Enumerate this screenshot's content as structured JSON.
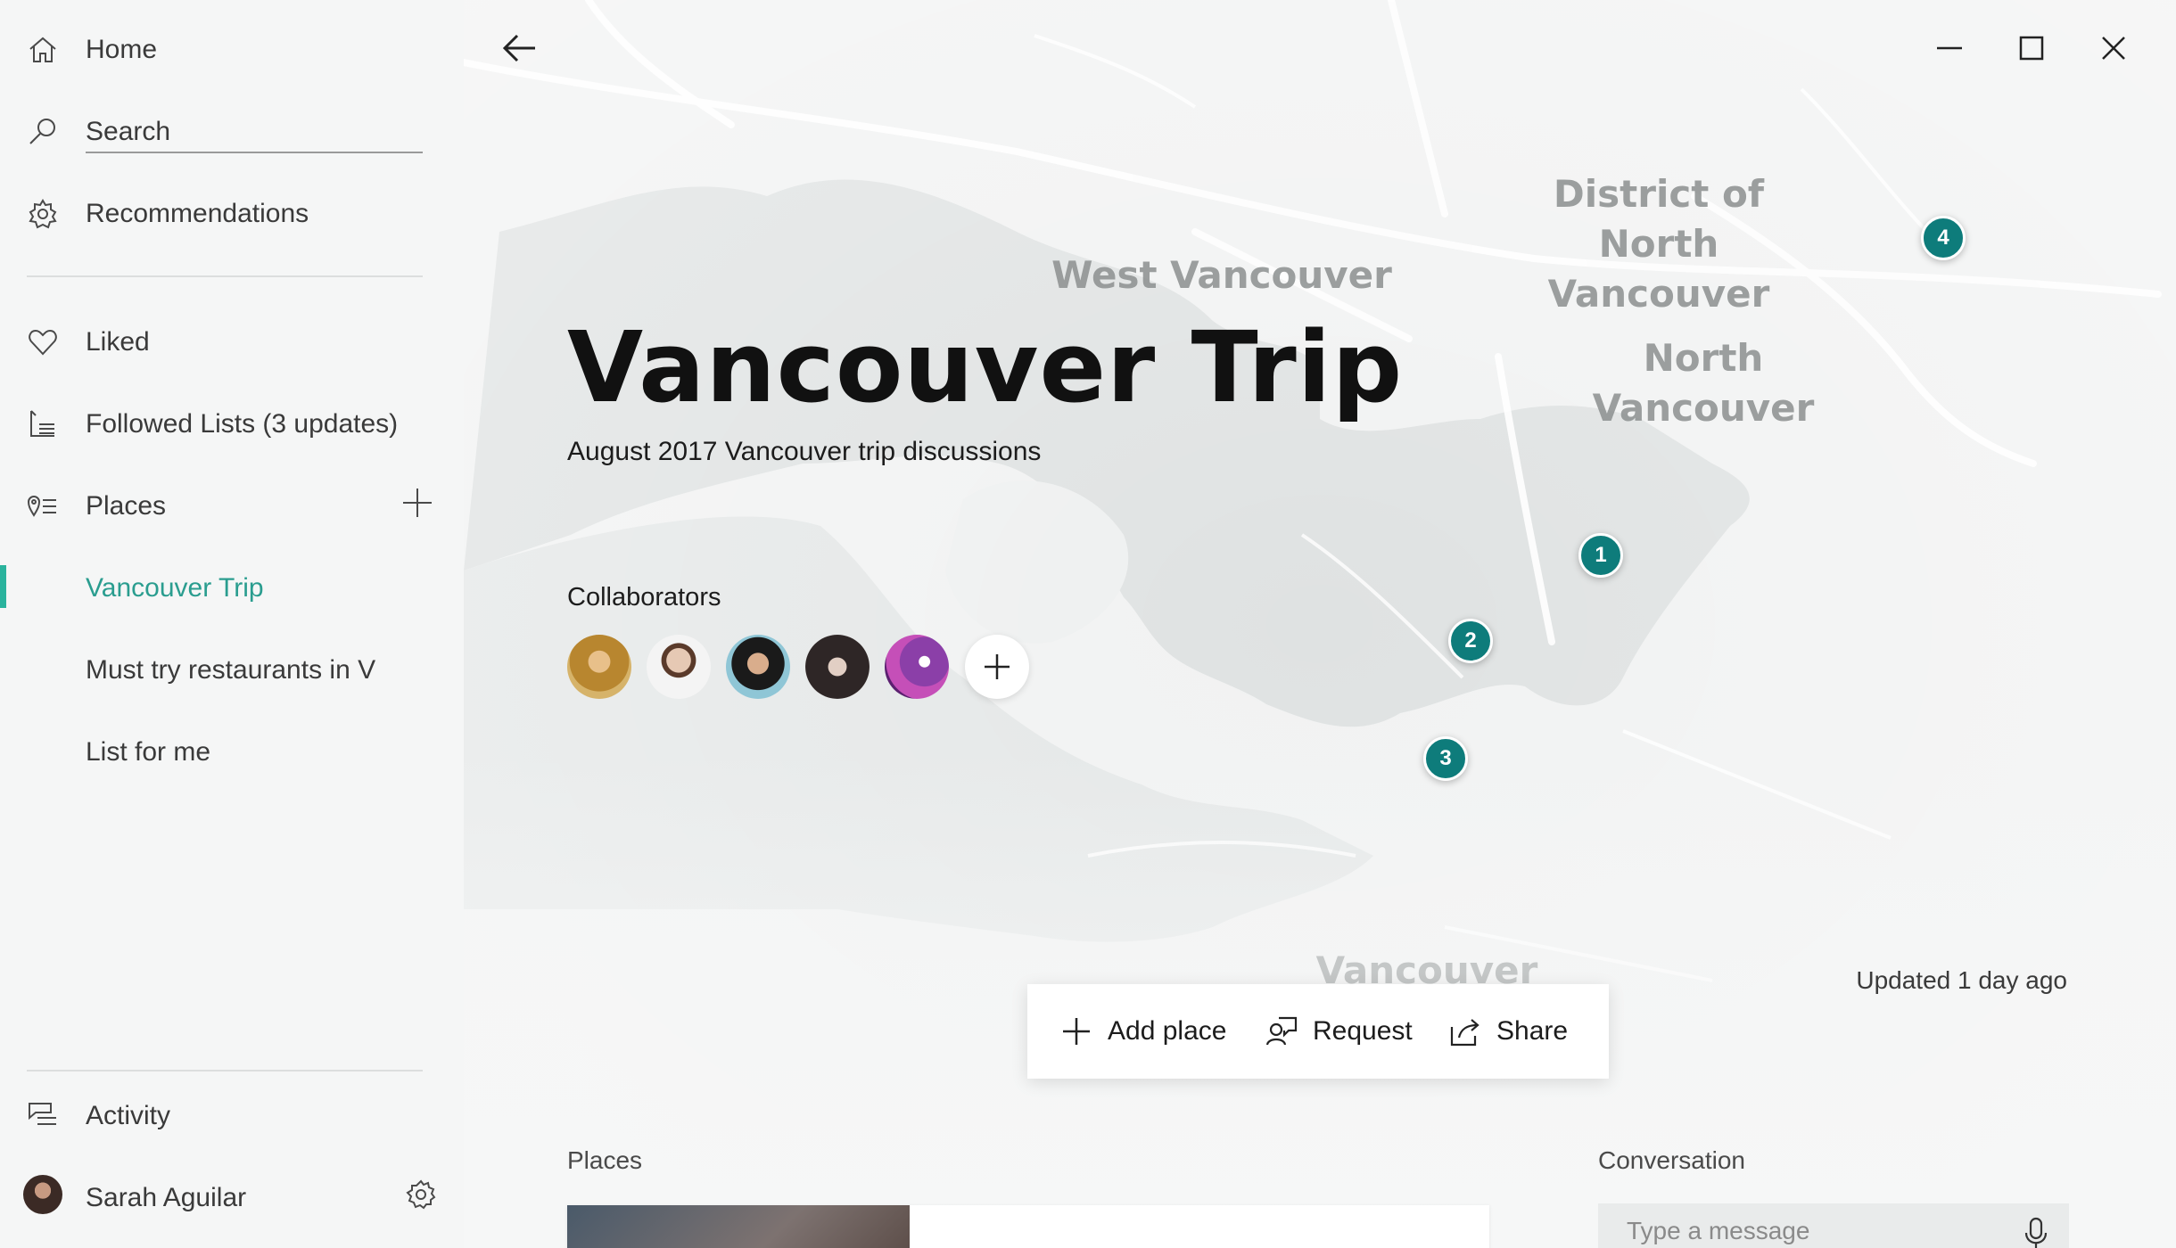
{
  "sidebar": {
    "home": "Home",
    "search_placeholder": "Search",
    "recommendations": "Recommendations",
    "liked": "Liked",
    "followed_lists": "Followed Lists (3 updates)",
    "places": "Places",
    "lists": [
      "Vancouver Trip",
      "Must try restaurants in V",
      "List for me"
    ],
    "activity": "Activity",
    "user_name": "Sarah Aguilar"
  },
  "map": {
    "labels": {
      "district_north_line1": "District of North",
      "district_north_line2": "Vancouver",
      "west_vancouver": "West Vancouver",
      "north_line1": "North",
      "north_line2": "Vancouver",
      "vancouver_bottom": "Vancouver"
    },
    "pins": [
      "1",
      "2",
      "3",
      "4"
    ]
  },
  "trip": {
    "title": "Vancouver Trip",
    "subtitle": "August 2017 Vancouver trip discussions",
    "collaborators_label": "Collaborators",
    "updated": "Updated 1 day ago"
  },
  "actions": {
    "add_place": "Add place",
    "request": "Request",
    "share": "Share"
  },
  "sections": {
    "places": "Places",
    "conversation": "Conversation",
    "message_placeholder": "Type a message"
  },
  "colors": {
    "accent": "#2ab39d",
    "pin": "#0e7c7b"
  }
}
